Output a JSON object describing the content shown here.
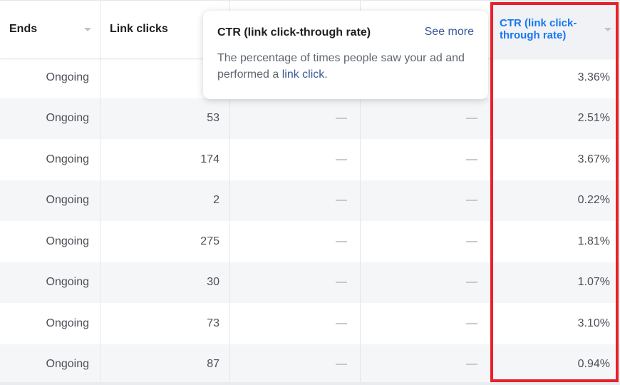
{
  "columns": [
    {
      "label": "Ends",
      "sortable": true
    },
    {
      "label": "Link clicks",
      "sortable": false
    },
    {
      "label": "",
      "sortable": false
    },
    {
      "label": "",
      "sortable": false
    },
    {
      "label": "CTR (link click-through rate)",
      "sortable": true,
      "active": true
    }
  ],
  "rows": [
    {
      "ends": "Ongoing",
      "link_clicks": "",
      "col3": "",
      "col4": "",
      "ctr": "3.36%"
    },
    {
      "ends": "Ongoing",
      "link_clicks": "53",
      "col3": "—",
      "col4": "—",
      "ctr": "2.51%"
    },
    {
      "ends": "Ongoing",
      "link_clicks": "174",
      "col3": "—",
      "col4": "—",
      "ctr": "3.67%"
    },
    {
      "ends": "Ongoing",
      "link_clicks": "2",
      "col3": "—",
      "col4": "—",
      "ctr": "0.22%"
    },
    {
      "ends": "Ongoing",
      "link_clicks": "275",
      "col3": "—",
      "col4": "—",
      "ctr": "1.81%"
    },
    {
      "ends": "Ongoing",
      "link_clicks": "30",
      "col3": "—",
      "col4": "—",
      "ctr": "1.07%"
    },
    {
      "ends": "Ongoing",
      "link_clicks": "73",
      "col3": "—",
      "col4": "—",
      "ctr": "3.10%"
    },
    {
      "ends": "Ongoing",
      "link_clicks": "87",
      "col3": "—",
      "col4": "—",
      "ctr": "0.94%"
    }
  ],
  "tooltip": {
    "title": "CTR (link click-through rate)",
    "see_more": "See more",
    "desc_prefix": "The percentage of times people saw your ad and performed a ",
    "desc_link": "link click",
    "desc_suffix": "."
  },
  "colors": {
    "active_header": "#1877f2",
    "highlight_border": "#e8212b",
    "link": "#385898"
  }
}
